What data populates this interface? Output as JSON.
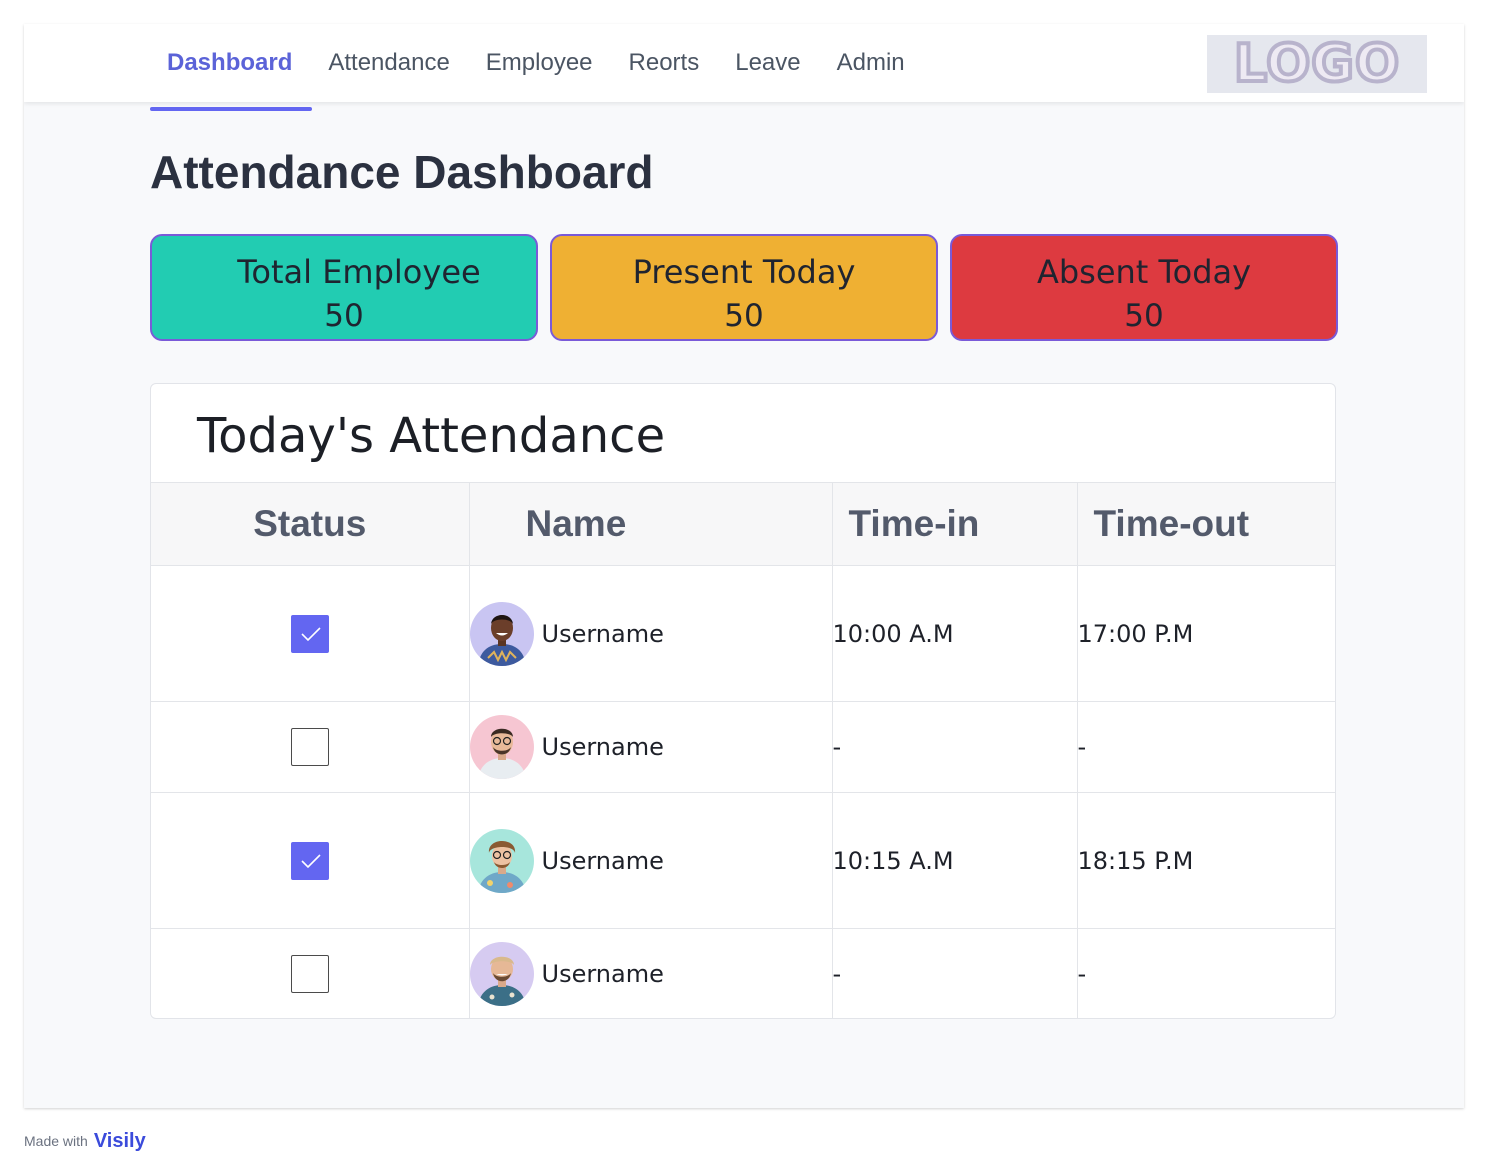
{
  "nav": {
    "items": [
      {
        "label": "Dashboard",
        "active": true
      },
      {
        "label": "Attendance",
        "active": false
      },
      {
        "label": "Employee",
        "active": false
      },
      {
        "label": "Reorts",
        "active": false
      },
      {
        "label": "Leave",
        "active": false
      },
      {
        "label": "Admin",
        "active": false
      }
    ],
    "logo_text": "LOGO"
  },
  "page": {
    "title": "Attendance Dashboard"
  },
  "stats": [
    {
      "label": "Total Employee",
      "value": "50",
      "color": "#22ccb2"
    },
    {
      "label": "Present Today",
      "value": "50",
      "color": "#efb033"
    },
    {
      "label": "Absent Today",
      "value": "50",
      "color": "#dd3a40"
    }
  ],
  "attendance": {
    "title": "Today's Attendance",
    "columns": [
      "Status",
      "Name",
      "Time-in",
      "Time-out"
    ],
    "rows": [
      {
        "checked": true,
        "name": "Username",
        "time_in": "10:00 A.M",
        "time_out": "17:00 P.M",
        "avatar_bg": "#c9c5f2"
      },
      {
        "checked": false,
        "name": "Username",
        "time_in": "-",
        "time_out": "-",
        "avatar_bg": "#f6c6d2"
      },
      {
        "checked": true,
        "name": "Username",
        "time_in": "10:15 A.M",
        "time_out": "18:15 P.M",
        "avatar_bg": "#a7e6dc"
      },
      {
        "checked": false,
        "name": "Username",
        "time_in": "-",
        "time_out": "-",
        "avatar_bg": "#d6cbf1"
      }
    ]
  },
  "footer": {
    "made_with": "Made with",
    "brand": "Visily"
  },
  "colors": {
    "accent": "#6366f1",
    "card_border": "#7a5ad8"
  }
}
